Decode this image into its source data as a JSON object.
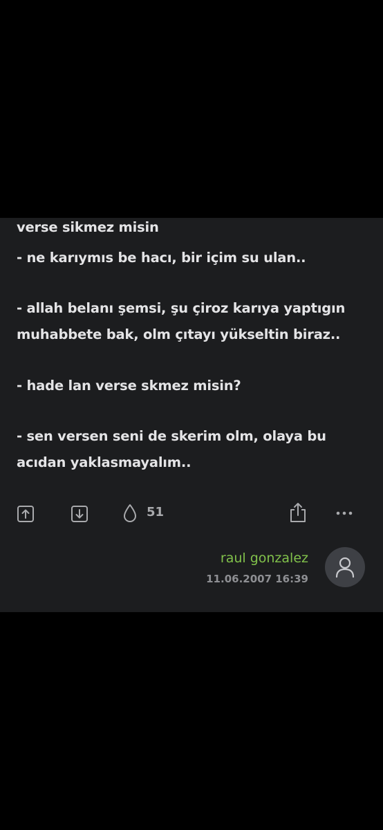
{
  "entry": {
    "lines": [
      "verse sikmez misin",
      "- ne karıymıs be hacı, bir içim su ulan..",
      "- allah belanı şemsi, şu çiroz karıya yaptıgın",
      "muhabbete bak, olm çıtayı yükseltin biraz..",
      "- hade lan verse skmez misin?",
      "- sen versen seni de skerim olm, olaya bu",
      "acıdan yaklasmayalım.."
    ]
  },
  "actions": {
    "upvote_icon": "arrow-up-box-icon",
    "downvote_icon": "arrow-down-box-icon",
    "favorite_icon": "drop-icon",
    "favorite_count": "51",
    "share_icon": "share-icon",
    "more_icon": "more-dots-icon"
  },
  "meta": {
    "author": "raul gonzalez",
    "date": "11.06.2007 16:39",
    "avatar_icon": "user-avatar-icon"
  },
  "colors": {
    "background": "#000000",
    "card": "#1c1d1f",
    "text": "#e4e4e6",
    "author": "#81c14b",
    "muted": "#8e8f93"
  }
}
